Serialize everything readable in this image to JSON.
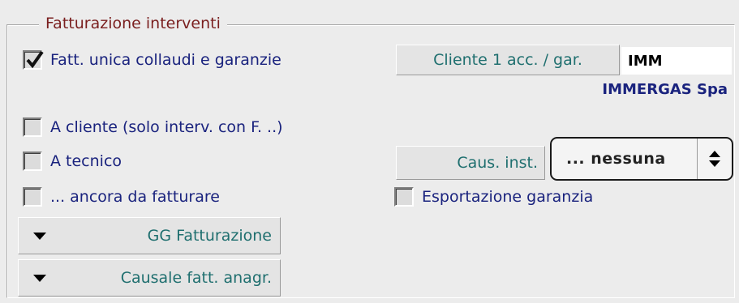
{
  "group": {
    "title": "Fatturazione interventi"
  },
  "checks": {
    "unica": {
      "label": "Fatt. unica collaudi e garanzie",
      "checked": true
    },
    "cliente": {
      "label": "A cliente (solo interv. con F. ..)",
      "checked": false
    },
    "tecnico": {
      "label": "A tecnico",
      "checked": false
    },
    "ancora": {
      "label": "... ancora da fatturare",
      "checked": false
    },
    "esportazione": {
      "label": "Esportazione garanzia",
      "checked": false
    }
  },
  "cliente_acc": {
    "button_label": "Cliente 1 acc. / gar.",
    "code": "IMM",
    "name": "IMMERGAS Spa"
  },
  "causale_inst": {
    "button_label": "Caus. inst.",
    "selected": "... nessuna"
  },
  "menus": {
    "gg_fatturazione": "GG Fatturazione",
    "causale_anagr": "Causale fatt. anagr."
  }
}
